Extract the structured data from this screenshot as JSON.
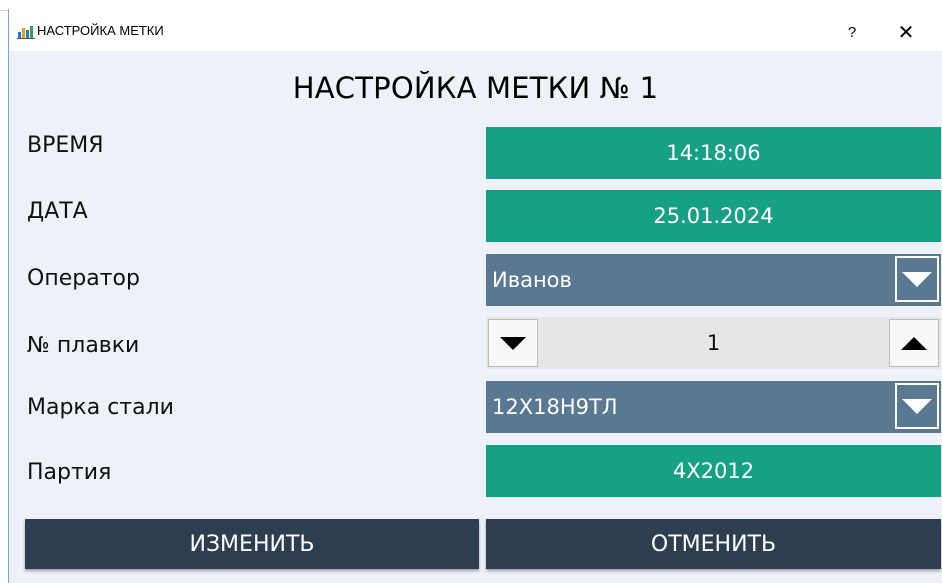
{
  "window": {
    "title": "НАСТРОЙКА МЕТКИ",
    "help_label": "?",
    "close_label": "✕"
  },
  "heading": "НАСТРОЙКА МЕТКИ № 1",
  "fields": {
    "time": {
      "label": "ВРЕМЯ",
      "value": "14:18:06"
    },
    "date": {
      "label": "ДАТА",
      "value": "25.01.2024"
    },
    "operator": {
      "label": "Оператор",
      "value": "Иванов"
    },
    "melt_number": {
      "label": "№ плавки",
      "value": "1"
    },
    "steel_grade": {
      "label": "Марка стали",
      "value": "12Х18Н9ТЛ"
    },
    "batch": {
      "label": "Партия",
      "value": "4Х2012"
    }
  },
  "buttons": {
    "change": "ИЗМЕНИТЬ",
    "cancel": "ОТМЕНИТЬ"
  },
  "colors": {
    "teal_field": "#16a085",
    "combo_bg": "#5a7891",
    "button_bg": "#2c3e50",
    "dialog_bg": "#eef2f8"
  },
  "icons": {
    "app": "chart-bars-icon",
    "combo_arrow": "triangle-down-icon",
    "spin_down": "triangle-down-icon",
    "spin_up": "triangle-up-icon"
  }
}
